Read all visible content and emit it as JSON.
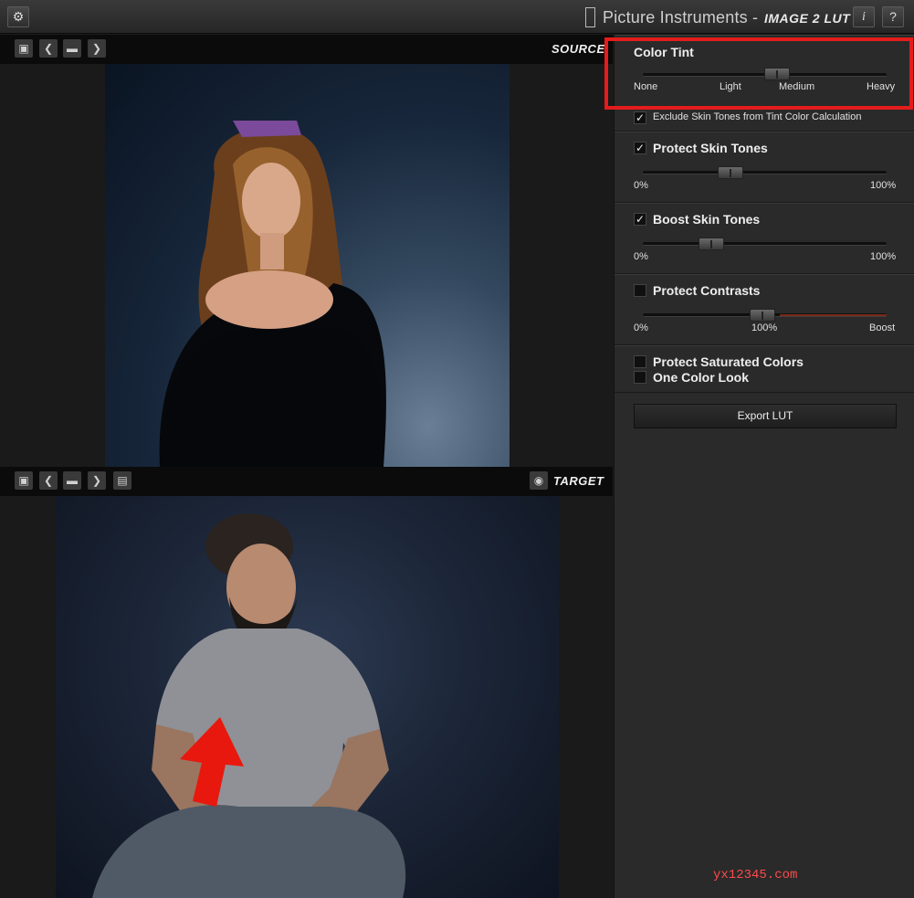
{
  "topbar": {
    "brand": "Picture Instruments -",
    "product": "IMAGE 2 LUT",
    "info_glyph": "i",
    "help_glyph": "?"
  },
  "source": {
    "label": "SOURCE"
  },
  "target": {
    "label": "TARGET"
  },
  "panel": {
    "color_tint": {
      "title": "Color Tint",
      "ticks": [
        "None",
        "Light",
        "Medium",
        "Heavy"
      ],
      "exclude_label": "Exclude Skin Tones from Tint Color Calculation",
      "exclude_checked": true,
      "level": 0.55
    },
    "protect_skin": {
      "title": "Protect Skin Tones",
      "checked": true,
      "min": "0%",
      "max": "100%",
      "value": 0.36
    },
    "boost_skin": {
      "title": "Boost Skin Tones",
      "checked": true,
      "min": "0%",
      "max": "100%",
      "value": 0.28
    },
    "protect_contrasts": {
      "title": "Protect Contrasts",
      "checked": false,
      "min": "0%",
      "mid": "100%",
      "max": "Boost",
      "value": 0.49
    },
    "protect_saturated": {
      "title": "Protect Saturated Colors",
      "checked": false
    },
    "one_color": {
      "title": "One Color Look",
      "checked": false
    },
    "export_label": "Export LUT"
  },
  "watermark": "yx12345.com",
  "colors": {
    "highlight": "#e41c1c",
    "arrow": "#e8180e",
    "panel_bg": "#2a2a2a"
  }
}
